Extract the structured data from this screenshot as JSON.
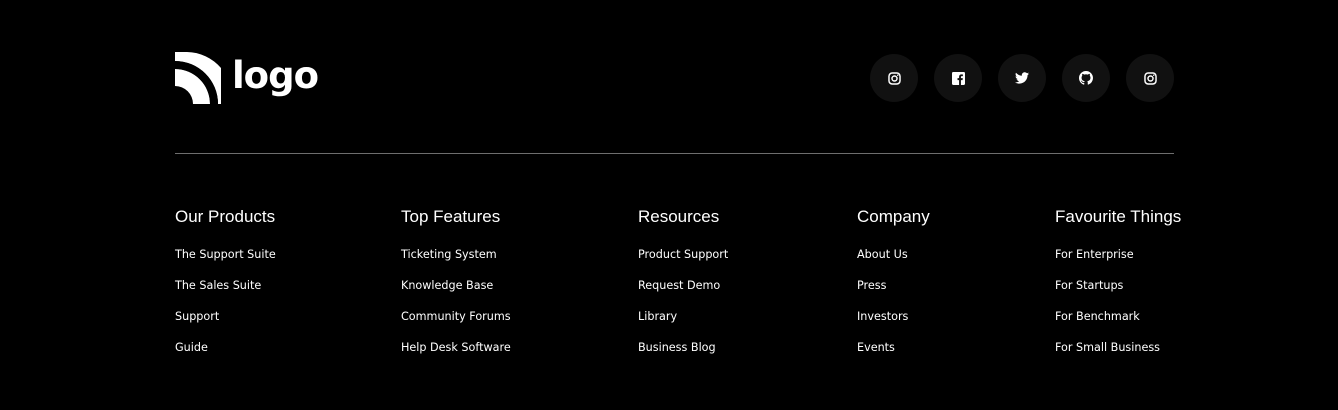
{
  "brand": {
    "logo_text": "logo",
    "logo_icon": "rss-arcs-icon"
  },
  "socials": [
    {
      "name": "Instagram",
      "icon": "instagram-icon"
    },
    {
      "name": "Facebook",
      "icon": "facebook-icon"
    },
    {
      "name": "Twitter",
      "icon": "twitter-icon"
    },
    {
      "name": "GitHub",
      "icon": "github-icon"
    },
    {
      "name": "Instagram",
      "icon": "instagram-icon"
    }
  ],
  "columns": [
    {
      "heading": "Our Products",
      "links": [
        "The Support Suite",
        "The Sales Suite",
        "Support",
        "Guide"
      ]
    },
    {
      "heading": "Top Features",
      "links": [
        "Ticketing System",
        "Knowledge Base",
        "Community Forums",
        "Help Desk Software"
      ]
    },
    {
      "heading": "Resources",
      "links": [
        "Product Support",
        "Request Demo",
        "Library",
        "Business Blog"
      ]
    },
    {
      "heading": "Company",
      "links": [
        "About Us",
        "Press",
        "Investors",
        "Events"
      ]
    },
    {
      "heading": "Favourite Things",
      "links": [
        "For Enterprise",
        "For Startups",
        "For Benchmark",
        "For Small Business"
      ]
    }
  ],
  "colors": {
    "background": "#000000",
    "text": "#ffffff",
    "social_button_bg": "#111111",
    "divider": "#6e6e6e"
  }
}
